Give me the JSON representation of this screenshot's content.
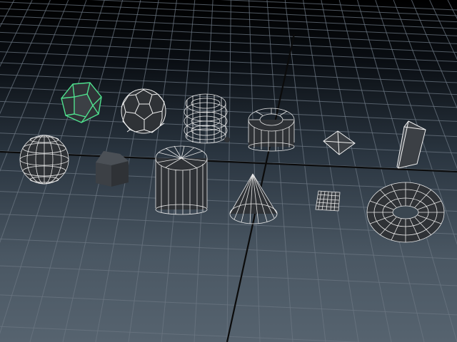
{
  "viewport": {
    "background_top": "#000000",
    "background_bottom": "#56636f",
    "grid_color": "#6b7682",
    "axis_color": "#0b0b0b",
    "wireframe_color": "#f2f2f2",
    "selection_color": "#4fe08e"
  },
  "objects": [
    {
      "name": "dodecahedron",
      "selected": true
    },
    {
      "name": "soccer-ball"
    },
    {
      "name": "helix"
    },
    {
      "name": "pipe"
    },
    {
      "name": "pyramid"
    },
    {
      "name": "prism"
    },
    {
      "name": "sphere"
    },
    {
      "name": "cube"
    },
    {
      "name": "cylinder"
    },
    {
      "name": "cone"
    },
    {
      "name": "plane"
    },
    {
      "name": "torus"
    }
  ]
}
